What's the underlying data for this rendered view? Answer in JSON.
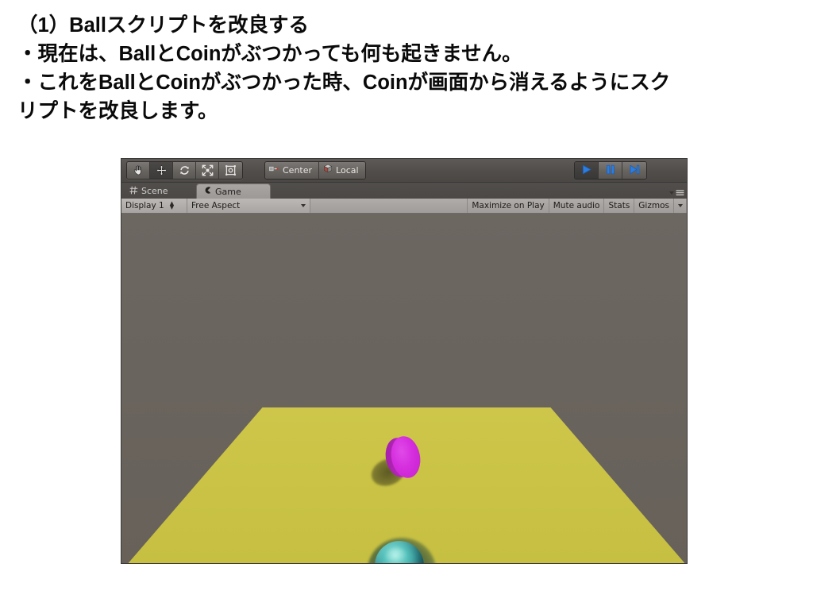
{
  "slide": {
    "lines": [
      "（1）Ballスクリプトを改良する",
      "・現在は、BallとCoinがぶつかっても何も起きません。",
      "・これをBallとCoinがぶつかった時、Coinが画面から消えるようにスク",
      "リプトを改良します。"
    ]
  },
  "unity": {
    "toolbar": {
      "transform_tools": [
        {
          "name": "hand-tool",
          "tooltip": "Hand Tool",
          "active": false
        },
        {
          "name": "move-tool",
          "tooltip": "Move Tool",
          "active": true
        },
        {
          "name": "rotate-tool",
          "tooltip": "Rotate Tool",
          "active": false
        },
        {
          "name": "scale-tool",
          "tooltip": "Scale Tool",
          "active": false
        },
        {
          "name": "rect-tool",
          "tooltip": "Rect Transform Tool",
          "active": false
        }
      ],
      "pivot_label": "Center",
      "rotation_label": "Local",
      "play_controls": [
        {
          "name": "play-button",
          "label": "Play",
          "engaged": true
        },
        {
          "name": "pause-button",
          "label": "Pause",
          "engaged": false
        },
        {
          "name": "step-button",
          "label": "Step",
          "engaged": false
        }
      ]
    },
    "tabs": [
      {
        "label": "Scene",
        "icon": "scene-grid-icon",
        "active": false
      },
      {
        "label": "Game",
        "icon": "game-pacman-icon",
        "active": true
      }
    ],
    "display_bar": {
      "display_label": "Display 1",
      "aspect_label": "Free Aspect",
      "maximize_label": "Maximize on Play",
      "mute_label": "Mute audio",
      "stats_label": "Stats",
      "gizmos_label": "Gizmos"
    },
    "game_view": {
      "background_color": "#6a645e",
      "floor_color": "#c9c246",
      "coin_color": "#d52ede",
      "ball_color": "#3aa09c",
      "objects": [
        {
          "name": "Coin",
          "shape": "cylinder",
          "color": "#d52ede"
        },
        {
          "name": "Ball",
          "shape": "sphere",
          "color": "#3aa09c"
        },
        {
          "name": "Floor",
          "shape": "plane",
          "color": "#c9c246"
        }
      ]
    }
  }
}
